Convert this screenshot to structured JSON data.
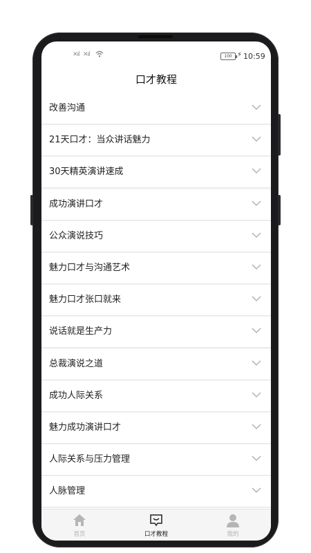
{
  "status": {
    "signal1": "✕ıl",
    "signal2": "✕ıl",
    "battery": "100",
    "time": "10:59"
  },
  "page": {
    "title": "口才教程"
  },
  "list": {
    "items": [
      {
        "label": "改善沟通"
      },
      {
        "label": "21天口才：当众讲话魅力"
      },
      {
        "label": "30天精英演讲速成"
      },
      {
        "label": "成功演讲口才"
      },
      {
        "label": "公众演说技巧"
      },
      {
        "label": "魅力口才与沟通艺术"
      },
      {
        "label": "魅力口才张口就来"
      },
      {
        "label": "说话就是生产力"
      },
      {
        "label": "总裁演说之道"
      },
      {
        "label": "成功人际关系"
      },
      {
        "label": "魅力成功演讲口才"
      },
      {
        "label": "人际关系与压力管理"
      },
      {
        "label": "人脉管理"
      }
    ]
  },
  "tabbar": {
    "tabs": [
      {
        "label": "首页",
        "icon": "home-icon",
        "active": false
      },
      {
        "label": "口才教程",
        "icon": "chat-icon",
        "active": true
      },
      {
        "label": "我的",
        "icon": "person-icon",
        "active": false
      }
    ],
    "active_color": "#222222",
    "inactive_color": "#b5b5b5"
  }
}
